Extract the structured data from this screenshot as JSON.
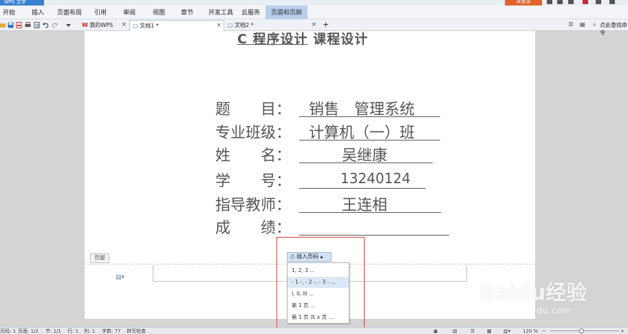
{
  "topbar": {
    "app_label": "WPS 文字",
    "login_label": "未登录"
  },
  "menu": {
    "items": [
      "开始",
      "插入",
      "页面布局",
      "引用",
      "审阅",
      "视图",
      "章节",
      "开发工具",
      "云服务",
      "页眉和页脚"
    ],
    "active": "页眉和页脚"
  },
  "tabs": [
    {
      "label": "我的WPS",
      "active": false
    },
    {
      "label": "文档1 *",
      "active": true
    },
    {
      "label": "文档2 *",
      "active": false
    }
  ],
  "new_tab_label": "+",
  "right_tools": {
    "search_label": "点此查找命令"
  },
  "document": {
    "title_underlined": "C 程序设计",
    "title_rest": "课程设计",
    "rows": [
      {
        "label": "题　　目：",
        "value": "销售　管理系统"
      },
      {
        "label": "专业班级：",
        "value": "计算机（一）班"
      },
      {
        "label": "姓　　名：",
        "value": "吴继康"
      },
      {
        "label": "学　　号：",
        "value": "13240124"
      },
      {
        "label": "指导教师：",
        "value": "王连相"
      },
      {
        "label": "成　　绩：",
        "value": ""
      }
    ]
  },
  "footer": {
    "label": "页脚"
  },
  "insert_page_number": {
    "button_label": "插入页码",
    "options": [
      "1, 2, 3 ...",
      "- 1 -, - 2 -, - 3 - ...",
      "I, II, III ...",
      "第 1 页 ...",
      "第 1 页 共 x 页 ..."
    ],
    "highlighted_index": 1
  },
  "statusbar": {
    "page_num": "页码: 1",
    "pages": "页面: 1/2",
    "section": "节: 1/1",
    "row": "行: 1",
    "col": "列: 1",
    "words": "字数: 77",
    "spell": "拼写检查",
    "zoom": "120 %"
  },
  "watermark": {
    "brand": "Baidu经验",
    "url": "jingyan.baidu.com"
  },
  "colors": {
    "accent": "#3a7fd0",
    "login": "#e2622b",
    "active_menu": "#b9cfe9",
    "highlight_box": "#d23a3a"
  }
}
